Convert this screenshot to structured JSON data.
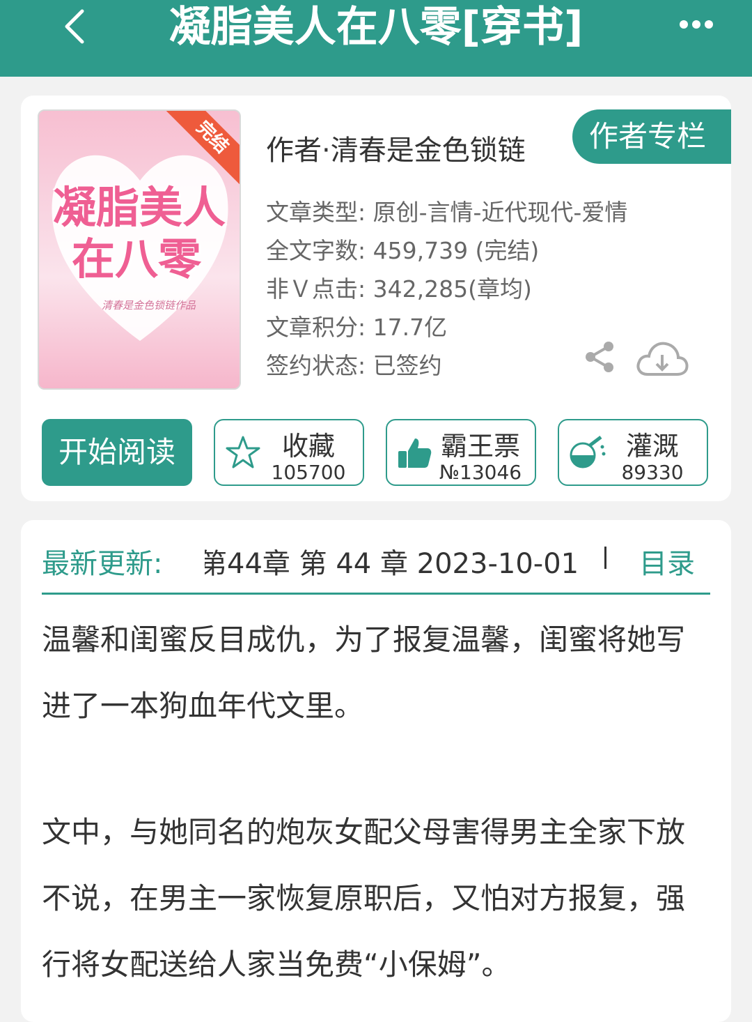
{
  "header": {
    "title": "凝脂美人在八零[穿书]",
    "back_icon": "back-arrow-icon",
    "more_icon": "more-dots-icon"
  },
  "book": {
    "cover": {
      "title_line1": "凝脂美人",
      "title_line2": "在八零",
      "signature": "清春是金色锁链作品",
      "ribbon": "完结"
    },
    "author": "作者·清春是金色锁链",
    "author_column_label": "作者专栏",
    "meta": [
      "文章类型: 原创-言情-近代现代-爱情",
      "全文字数: 459,739 (完结)",
      "非Ｖ点击: 342,285(章均)",
      "文章积分: 17.7亿",
      "签约状态: 已签约"
    ],
    "actions": {
      "read_label": "开始阅读",
      "favorite": {
        "label": "收藏",
        "count": "105700"
      },
      "vote": {
        "label": "霸王票",
        "count": "№13046"
      },
      "water": {
        "label": "灌溉",
        "count": "89330"
      }
    }
  },
  "update": {
    "label": "最新更新:",
    "text": "第44章  第 44 章  2023-10-01",
    "toc_label": "目录"
  },
  "description": {
    "paragraphs": [
      "温馨和闺蜜反目成仇，为了报复温馨，闺蜜将她写进了一本狗血年代文里。",
      "文中，与她同名的炮灰女配父母害得男主全家下放不说，在男主一家恢复原职后，又怕对方报复，强行将女配送给人家当免费“小保姆”。"
    ]
  },
  "colors": {
    "accent": "#2e9b8b",
    "ribbon": "#ee5a3c",
    "cover_pink": "#ef5f93"
  }
}
